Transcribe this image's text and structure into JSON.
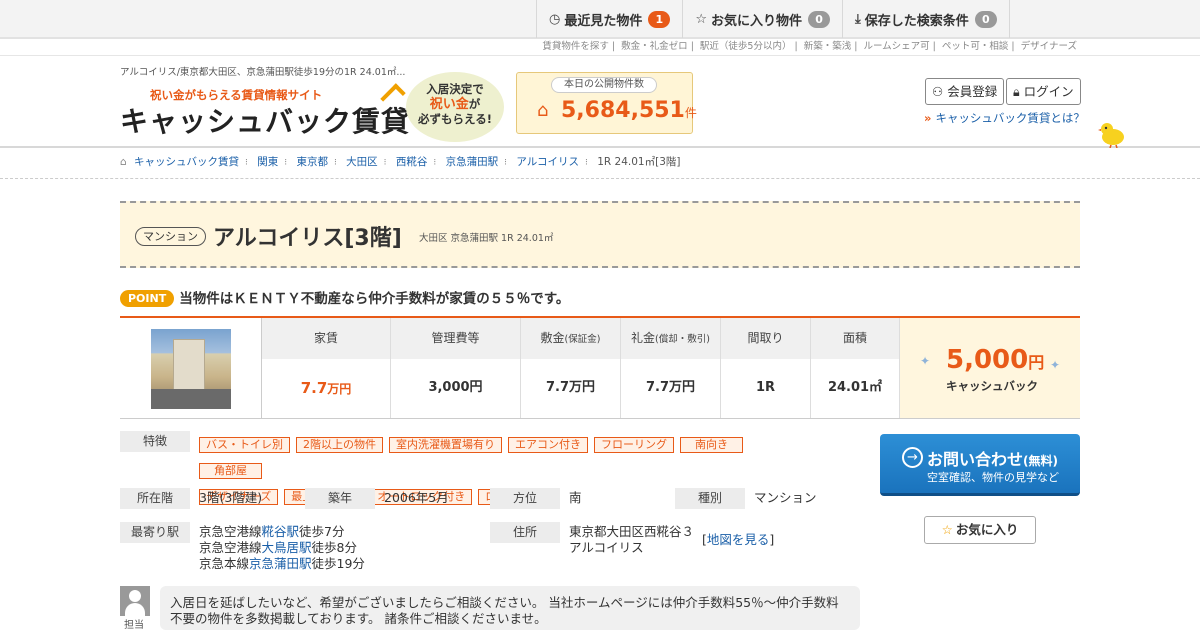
{
  "topbar": {
    "recent": {
      "label": "最近見た物件",
      "count": "1"
    },
    "favorites": {
      "label": "お気に入り物件",
      "count": "0"
    },
    "saved": {
      "label": "保存した検索条件",
      "count": "0"
    }
  },
  "sublinks": [
    "賃貸物件を探す",
    "敷金・礼金ゼロ",
    "駅近（徒歩5分以内）",
    "新築・築浅",
    "ルームシェア可",
    "ペット可・相談",
    "デザイナーズ"
  ],
  "header": {
    "page_caption": "アルコイリス/東京都大田区、京急蒲田駅徒歩19分の1R 24.01㎡...",
    "logo_tagline": "祝い金がもらえる賃貸情報サイト",
    "logo_main": "キャッシュバック賃貸",
    "cloud_line1": "入居決定で",
    "cloud_line2": "祝い金",
    "cloud_line2b": "が",
    "cloud_line3": "必ずもらえる!",
    "count_label": "本日の公開物件数",
    "count_value": "5,684,551",
    "count_unit": "件",
    "register": "会員登録",
    "login": "ログイン",
    "what_is": "キャッシュバック賃貸とは？"
  },
  "breadcrumb": [
    "キャッシュバック賃貸",
    "関東",
    "東京都",
    "大田区",
    "西糀谷",
    "京急蒲田駅",
    "アルコイリス",
    "1R 24.01㎡[3階]"
  ],
  "property": {
    "type": "マンション",
    "name": "アルコイリス[3階]",
    "subtitle": "大田区 京急蒲田駅 1R 24.01㎡",
    "point_label": "POINT",
    "point_text": "当物件はＫＥＮＴＹ不動産なら仲介手数料が家賃の５５％です。"
  },
  "spec": {
    "rent_h": "家賃",
    "rent_v": "7.7",
    "rent_unit": "万円",
    "mgmt_h": "管理費等",
    "mgmt_v": "3,000円",
    "deposit_h": "敷金",
    "deposit_sub": "(保証金)",
    "deposit_v": "7.7万円",
    "key_h": "礼金",
    "key_sub": "(償却・敷引)",
    "key_v": "7.7万円",
    "layout_h": "間取り",
    "layout_v": "1R",
    "area_h": "面積",
    "area_v": "24.01㎡",
    "cashback_amount": "5,000",
    "cashback_unit": "円",
    "cashback_label": "キャッシュバック"
  },
  "features": {
    "label": "特徴",
    "tags": [
      "バス・トイレ別",
      "2階以上の物件",
      "室内洗濯機置場有り",
      "エアコン付き",
      "フローリング",
      "南向き",
      "角部屋",
      "デザイナーズ",
      "最上階の物件",
      "オートロック付き",
      "ロフト付き"
    ]
  },
  "details": {
    "floor_l": "所在階",
    "floor_v": "3階(3階建)",
    "built_l": "築年",
    "built_v": "2006年5月",
    "dir_l": "方位",
    "dir_v": "南",
    "kind_l": "種別",
    "kind_v": "マンション",
    "station_l": "最寄り駅",
    "stations": [
      {
        "line": "京急空港線",
        "station": "糀谷駅",
        "walk": "徒歩7分"
      },
      {
        "line": "京急空港線",
        "station": "大鳥居駅",
        "walk": "徒歩8分"
      },
      {
        "line": "京急本線",
        "station": "京急蒲田駅",
        "walk": "徒歩19分"
      }
    ],
    "addr_l": "住所",
    "addr_line1": "東京都大田区西糀谷３",
    "addr_line2": "アルコイリス",
    "map_link": "地図を見る"
  },
  "inquiry": {
    "title": "お問い合わせ",
    "free": "(無料)",
    "sub": "空室確認、物件の見学など"
  },
  "favorite_btn": "お気に入り",
  "staff": {
    "label": "担当",
    "message": "入居日を延ばしたいなど、希望がございましたらご相談ください。 当社ホームページには仲介手数料55％～仲介手数料不要の物件を多数掲載しております。 諸条件ご相談くださいませ。"
  }
}
